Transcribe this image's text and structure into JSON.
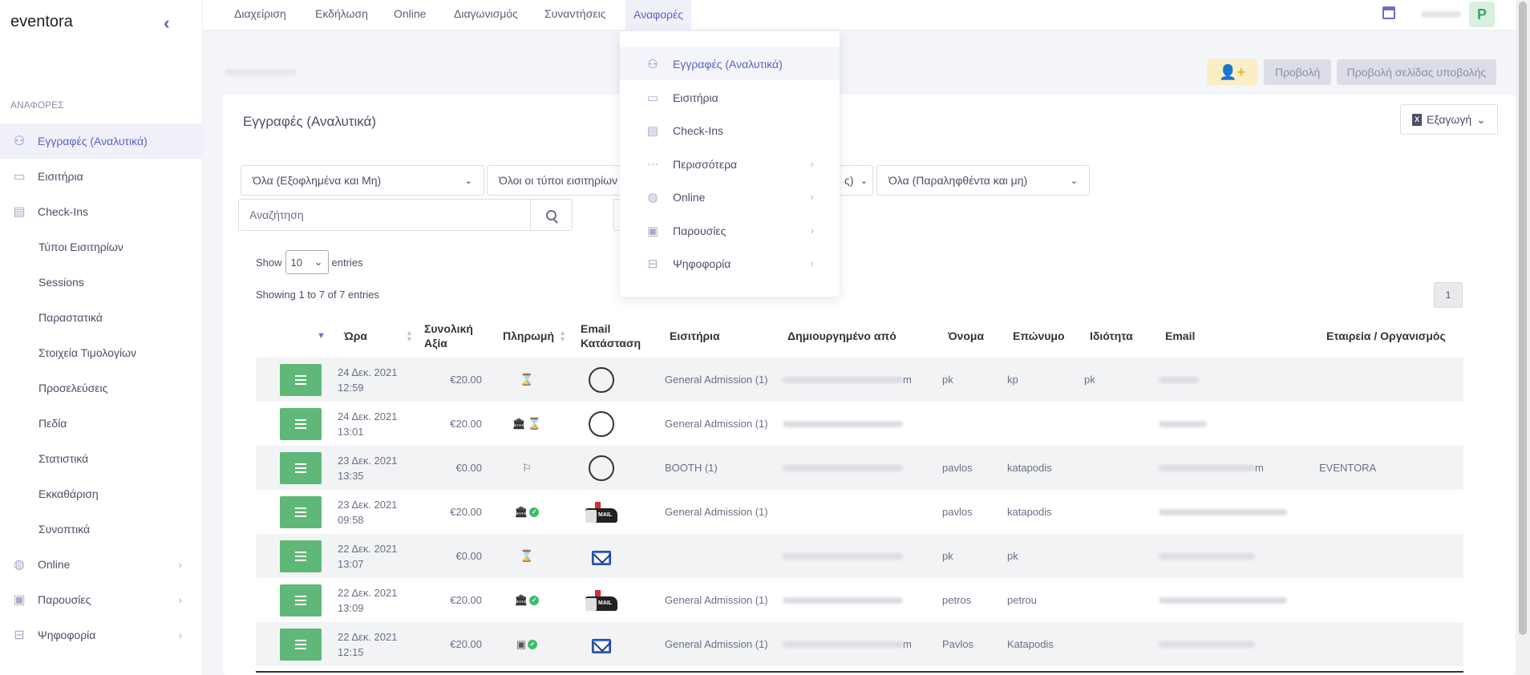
{
  "app": {
    "logo": "eventora",
    "collapse_icon": "double-chevron-left-icon"
  },
  "sidebar": {
    "section": "ΑΝΑΦΟΡΕΣ",
    "items": [
      {
        "label": "Εγγραφές (Αναλυτικά)",
        "icon": "users-icon",
        "active": true
      },
      {
        "label": "Εισιτήρια",
        "icon": "ticket-icon"
      },
      {
        "label": "Check-Ins",
        "icon": "clipboard-icon"
      },
      {
        "label": "Τύποι Εισιτηρίων"
      },
      {
        "label": "Sessions"
      },
      {
        "label": "Παραστατικά"
      },
      {
        "label": "Στοιχεία Τιμολογίων"
      },
      {
        "label": "Προσελεύσεις"
      },
      {
        "label": "Πεδία"
      },
      {
        "label": "Στατιστικά"
      },
      {
        "label": "Εκκαθάριση"
      },
      {
        "label": "Συνοπτικά"
      },
      {
        "label": "Online",
        "icon": "globe-icon"
      },
      {
        "label": "Παρουσίες",
        "icon": "badge-icon"
      },
      {
        "label": "Ψηφοφορία",
        "icon": "ballot-box-icon"
      }
    ]
  },
  "topnav": {
    "tabs": [
      "Διαχείριση",
      "Εκδήλωση",
      "Online",
      "Διαγωνισμός",
      "Συναντήσεις",
      "Αναφορές"
    ],
    "active": "Αναφορές",
    "avatar_letter": "P",
    "calendar_icon": "calendar-icon"
  },
  "actions": {
    "add_user_icon": "add-user-icon",
    "preview_label": "Προβολή",
    "preview_submit_label": "Προβολή σελίδας υποβολής"
  },
  "card": {
    "title": "Εγγραφές (Αναλυτικά)",
    "export_label": "Εξαγωγή",
    "filters": {
      "payment": "Όλα (Εξοφλημένα και Μη)",
      "ticket_types": "Όλοι οι τύποι εισιτηρίων",
      "partial": "ς)",
      "received": "Όλα (Παραληφθέντα και μη)"
    },
    "search_placeholder": "Αναζήτηση",
    "show_label": "Show",
    "entries_label": "entries",
    "page_length": "10",
    "showing_text": "Showing 1 to 7 of 7 entries",
    "page": "1"
  },
  "table": {
    "headers": {
      "time": "Ώρα",
      "total_1": "Συνολική",
      "total_2": "Αξία",
      "payment": "Πληρωμή",
      "email_1": "Email",
      "email_2": "Κατάσταση",
      "tickets": "Εισιτήρια",
      "created_by": "Δημιουργημένο από",
      "first_name": "Όνομα",
      "last_name": "Επώνυμο",
      "property": "Ιδιότητα",
      "email": "Email",
      "company": "Εταιρεία / Οργανισμός"
    },
    "rows": [
      {
        "date": "24 Δεκ. 2021",
        "time": "12:59",
        "amount": "€20.00",
        "payment": [
          "hourglass"
        ],
        "email_status": "empty",
        "tickets": "General Admission (1)",
        "created_tail": "m",
        "first": "pk",
        "last": "kp",
        "property": "pk",
        "email_tail": "",
        "company": ""
      },
      {
        "date": "24 Δεκ. 2021",
        "time": "13:01",
        "amount": "€20.00",
        "payment": [
          "bank",
          "hourglass"
        ],
        "email_status": "empty",
        "tickets": "General Admission (1)",
        "created_tail": "",
        "first": "",
        "last": "",
        "property": "",
        "email_tail": "",
        "company": ""
      },
      {
        "date": "23 Δεκ. 2021",
        "time": "13:35",
        "amount": "€0.00",
        "payment": [
          "flag"
        ],
        "email_status": "empty",
        "tickets": "BOOTH (1)",
        "created_tail": "",
        "first": "pavlos",
        "last": "katapodis",
        "property": "",
        "email_tail": "m",
        "company": "EVENTORA"
      },
      {
        "date": "23 Δεκ. 2021",
        "time": "09:58",
        "amount": "€20.00",
        "payment": [
          "bank",
          "check"
        ],
        "email_status": "mailbox",
        "tickets": "General Admission (1)",
        "created_tail": "",
        "first": "pavlos",
        "last": "katapodis",
        "property": "",
        "email_tail": "",
        "company": ""
      },
      {
        "date": "22 Δεκ. 2021",
        "time": "13:07",
        "amount": "€0.00",
        "payment": [
          "hourglass"
        ],
        "email_status": "envelope",
        "tickets": "",
        "created_tail": "",
        "first": "pk",
        "last": "pk",
        "property": "",
        "email_tail": "",
        "company": ""
      },
      {
        "date": "22 Δεκ. 2021",
        "time": "13:09",
        "amount": "€20.00",
        "payment": [
          "bank",
          "check"
        ],
        "email_status": "mailbox",
        "tickets": "General Admission (1)",
        "created_tail": "",
        "first": "petros",
        "last": "petrou",
        "property": "",
        "email_tail": "",
        "company": ""
      },
      {
        "date": "22 Δεκ. 2021",
        "time": "12:15",
        "amount": "€20.00",
        "payment": [
          "cash",
          "check"
        ],
        "email_status": "envelope",
        "tickets": "General Admission (1)",
        "created_tail": "m",
        "first": "Pavlos",
        "last": "Katapodis",
        "property": "",
        "email_tail": "",
        "company": ""
      }
    ]
  },
  "dropdown": {
    "items": [
      {
        "label": "Εγγραφές (Αναλυτικά)",
        "icon": "users-icon",
        "active": true
      },
      {
        "label": "Εισιτήρια",
        "icon": "ticket-icon"
      },
      {
        "label": "Check-Ins",
        "icon": "clipboard-icon"
      },
      {
        "label": "Περισσότερα",
        "icon": "ellipsis-icon",
        "sub": true
      },
      {
        "label": "Online",
        "icon": "globe-icon",
        "sub": true
      },
      {
        "label": "Παρουσίες",
        "icon": "badge-icon",
        "sub": true
      },
      {
        "label": "Ψηφοφορία",
        "icon": "ballot-box-icon",
        "sub": true
      }
    ]
  },
  "colors": {
    "accent": "#5a60c8",
    "success": "#5fb878",
    "warning": "#e0a040"
  }
}
